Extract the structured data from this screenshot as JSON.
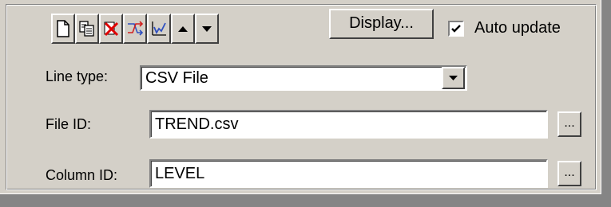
{
  "toolbar": {
    "icons": [
      "new-document-icon",
      "copy-icon",
      "delete-icon",
      "shuffle-icon",
      "trend-chart-icon",
      "arrow-up-icon",
      "arrow-down-icon"
    ],
    "display_label": "Display...",
    "auto_update_label": "Auto update",
    "auto_update_checked": true
  },
  "form": {
    "line_type_label": "Line type:",
    "line_type_value": "CSV File",
    "file_id_label": "File ID:",
    "file_id_value": "TREND.csv",
    "column_id_label": "Column ID:",
    "column_id_value": "LEVEL",
    "browse_label": "..."
  },
  "colors": {
    "face": "#d4d0c8",
    "shadow": "#808080",
    "highlight": "#ffffff",
    "delete_red": "#e00000",
    "icon_blue": "#3050c0"
  }
}
